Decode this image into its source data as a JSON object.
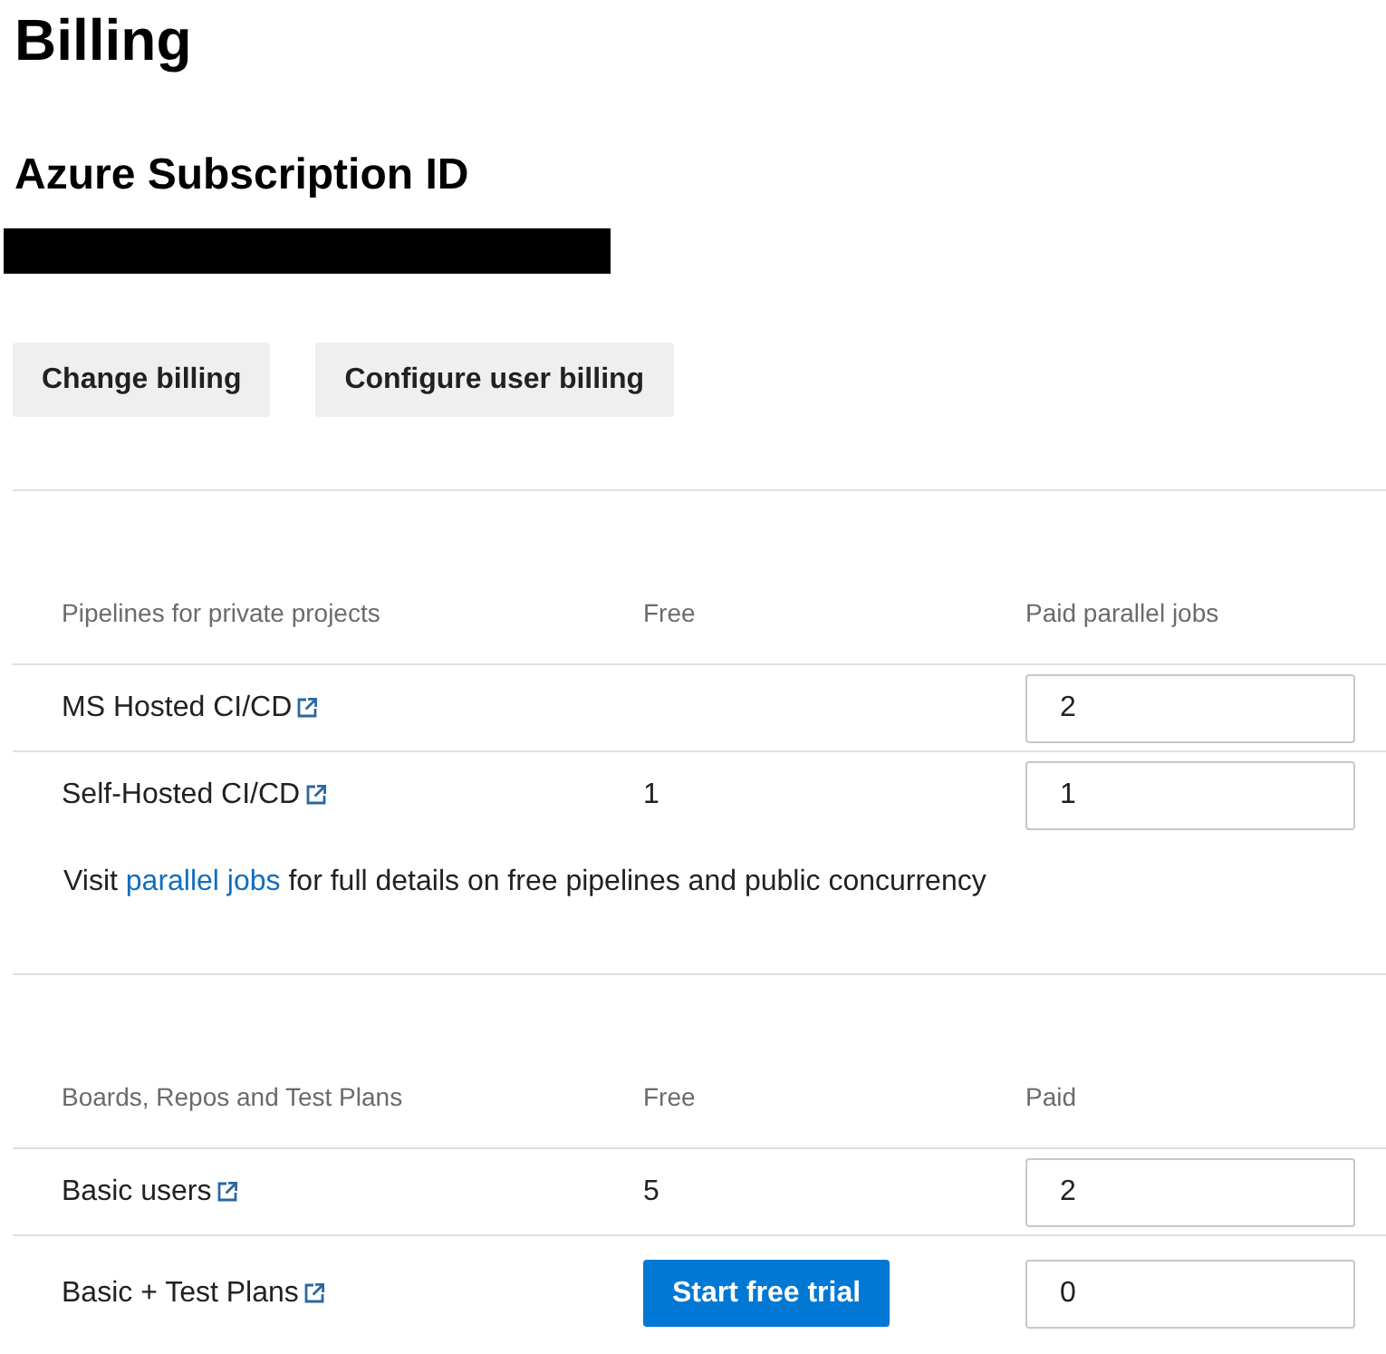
{
  "page": {
    "title": "Billing"
  },
  "subscription": {
    "heading": "Azure Subscription ID",
    "id_redacted": true
  },
  "buttons": [
    {
      "label": "Change billing"
    },
    {
      "label": "Configure user billing"
    }
  ],
  "sections": [
    {
      "columns": [
        "Pipelines for private projects",
        "Free",
        "Paid parallel jobs"
      ],
      "rows": [
        {
          "name": "MS Hosted CI/CD",
          "paid": "2"
        },
        {
          "name": "Self-Hosted CI/CD",
          "free": {
            "kind": "text",
            "text": "1"
          },
          "paid": "1"
        }
      ],
      "note": {
        "before": "Visit",
        "link": "parallel jobs",
        "after": "for full details on free pipelines and public concurrency"
      }
    },
    {
      "columns": [
        "Boards, Repos and Test Plans",
        "Free",
        "Paid"
      ],
      "rows": [
        {
          "name": "Basic users",
          "free": {
            "kind": "text",
            "text": "5"
          },
          "paid": "2"
        },
        {
          "name": "Basic + Test Plans",
          "free": {
            "kind": "button",
            "label": "Start free trial"
          },
          "paid": "0"
        }
      ]
    }
  ]
}
